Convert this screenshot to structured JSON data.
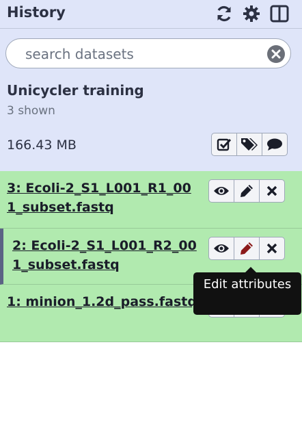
{
  "header": {
    "title": "History",
    "icons": [
      "refresh-icon",
      "gear-icon",
      "columns-icon"
    ]
  },
  "search": {
    "placeholder": "search datasets",
    "value": ""
  },
  "history": {
    "name": "Unicycler training",
    "shown": "3 shown",
    "size": "166.43 MB",
    "actions": [
      "check-square-icon",
      "tags-icon",
      "comment-icon"
    ]
  },
  "datasets": [
    {
      "label": "3: Ecoli-2_S1_L001_R1_001_subset.fastq",
      "state_color": "#b1eaaf"
    },
    {
      "label": "2: Ecoli-2_S1_L001_R2_001_subset.fastq",
      "state_color": "#b1eaaf"
    },
    {
      "label": "1: minion_1.2d_pass.fastq",
      "state_color": "#b1eaaf"
    }
  ],
  "tooltip": {
    "text": "Edit attributes"
  },
  "colors": {
    "panel": "#dfe5f9",
    "dataset_ok": "#b1eaaf",
    "edit_active": "#8b1a1a"
  }
}
